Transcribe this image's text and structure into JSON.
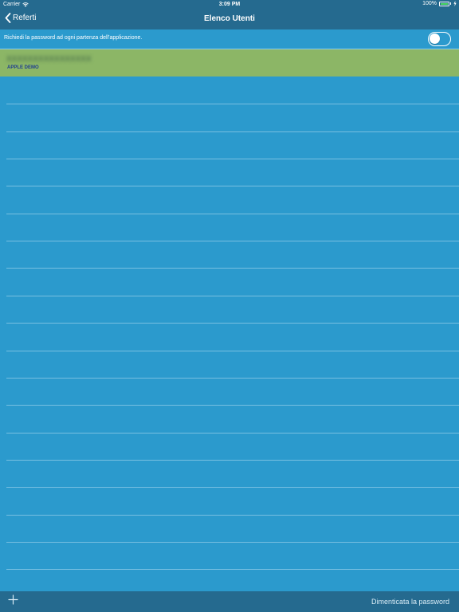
{
  "status_bar": {
    "carrier": "Carrier",
    "time": "3:09 PM",
    "battery": "100%",
    "battery_level": 1.0
  },
  "nav": {
    "back_label": "Referti",
    "title": "Elenco Utenti"
  },
  "settings": {
    "password_prompt_label": "Richiedi la password ad ogni partenza dell'applicazione.",
    "password_prompt_enabled": false
  },
  "users": [
    {
      "name": "XXXXXXXXXXXXXXXX",
      "subtitle": "APPLE DEMO"
    }
  ],
  "toolbar": {
    "forgot_password_label": "Dimenticata la password"
  },
  "colors": {
    "background": "#2b9acd",
    "bar": "#256a8f",
    "selected_row": "#8cb666",
    "subtitle": "#1f3d8f"
  }
}
